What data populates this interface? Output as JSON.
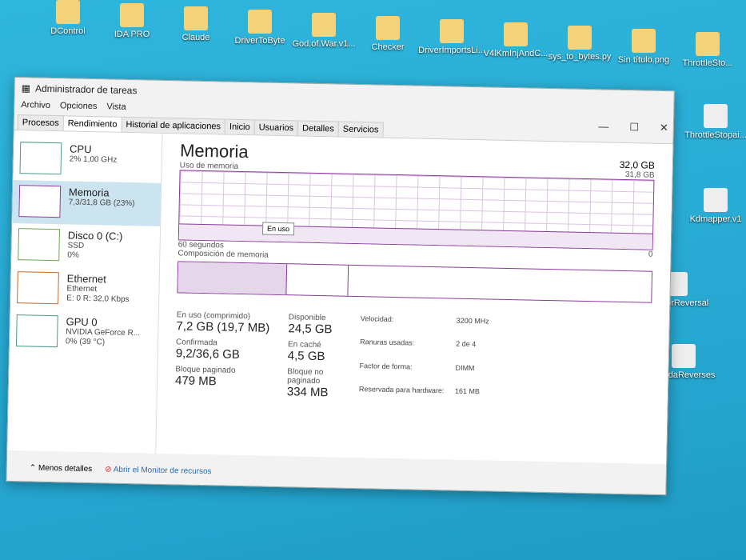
{
  "desktop": {
    "icons": [
      "DControl",
      "IDA PRO",
      "Claude",
      "DriverToByte",
      "God.of.War.v1...",
      "Checker",
      "DriverImportsLi...",
      "V4lKmInjAndC...",
      "sys_to_bytes.py",
      "Sin título.png",
      "ThrottleSto..."
    ],
    "right_icons": [
      "ThrottleStopai...",
      "Kdmapper.v1",
      "OnlyForReversal",
      "OldIdaReverses"
    ]
  },
  "window": {
    "title": "Administrador de tareas",
    "menu": [
      "Archivo",
      "Opciones",
      "Vista"
    ],
    "tabs": [
      "Procesos",
      "Rendimiento",
      "Historial de aplicaciones",
      "Inicio",
      "Usuarios",
      "Detalles",
      "Servicios"
    ],
    "controls": {
      "minimize": "—",
      "maximize": "☐",
      "close": "✕"
    }
  },
  "sidebar": [
    {
      "name": "CPU",
      "l1": "2% 1,00 GHz",
      "l2": ""
    },
    {
      "name": "Memoria",
      "l1": "7,3/31,8 GB (23%)",
      "l2": ""
    },
    {
      "name": "Disco 0 (C:)",
      "l1": "SSD",
      "l2": "0%"
    },
    {
      "name": "Ethernet",
      "l1": "Ethernet",
      "l2": "E: 0 R: 32,0 Kbps"
    },
    {
      "name": "GPU 0",
      "l1": "NVIDIA GeForce R...",
      "l2": "0% (39 °C)"
    }
  ],
  "main": {
    "title": "Memoria",
    "total": "32,0 GB",
    "usage_label": "Uso de memoria",
    "max": "31,8 GB",
    "time": "60 segundos",
    "zero": "0",
    "tooltip": "En uso",
    "composition_label": "Composición de memoria",
    "usage_percent": 23,
    "stats": [
      {
        "label": "En uso (comprimido)",
        "value": "7,2 GB (19,7 MB)"
      },
      {
        "label": "Disponible",
        "value": "24,5 GB"
      },
      {
        "label": "Confirmada",
        "value": "9,2/36,6 GB"
      },
      {
        "label": "En caché",
        "value": "4,5 GB"
      },
      {
        "label": "Bloque paginado",
        "value": "479 MB"
      },
      {
        "label": "Bloque no paginado",
        "value": "334 MB"
      }
    ],
    "props": [
      [
        "Velocidad:",
        "3200 MHz"
      ],
      [
        "Ranuras usadas:",
        "2 de 4"
      ],
      [
        "Factor de forma:",
        "DIMM"
      ],
      [
        "Reservada para hardware:",
        "161 MB"
      ]
    ]
  },
  "footer": {
    "less": "Menos detalles",
    "monitor": "Abrir el Monitor de recursos"
  }
}
